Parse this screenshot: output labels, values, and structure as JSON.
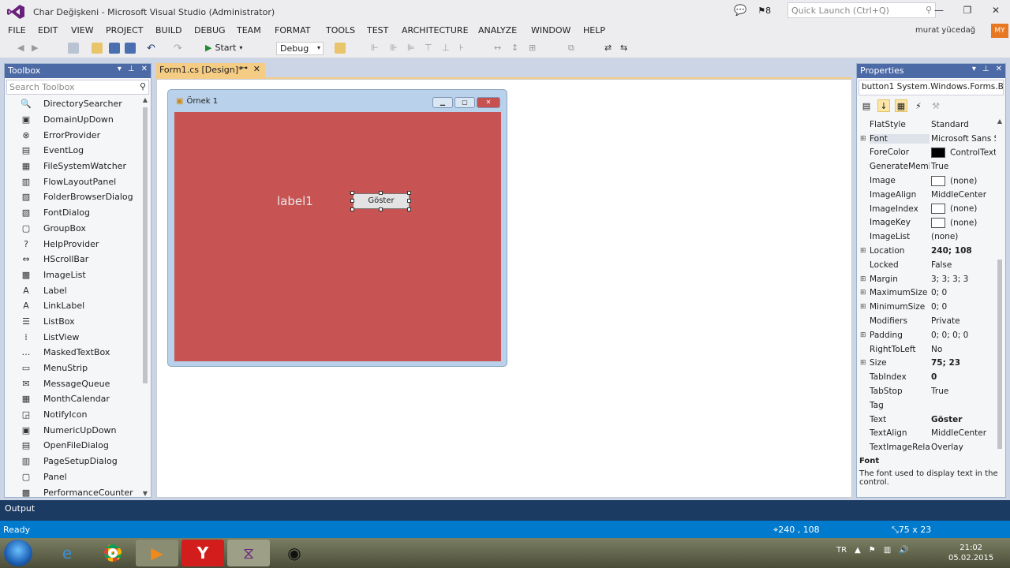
{
  "window": {
    "title": "Char Değişkeni - Microsoft Visual Studio (Administrator)",
    "notifications": "8",
    "quick_launch_placeholder": "Quick Launch (Ctrl+Q)"
  },
  "menu": {
    "items": [
      "FILE",
      "EDIT",
      "VIEW",
      "PROJECT",
      "BUILD",
      "DEBUG",
      "TEAM",
      "FORMAT",
      "TOOLS",
      "TEST",
      "ARCHITECTURE",
      "ANALYZE",
      "WINDOW",
      "HELP"
    ],
    "user": "murat yücedağ",
    "avatar": "MY"
  },
  "toolbar": {
    "start_label": "Start",
    "config": "Debug"
  },
  "toolbox": {
    "title": "Toolbox",
    "search_placeholder": "Search Toolbox",
    "items": [
      {
        "label": "DirectorySearcher",
        "icon": "directory-searcher-icon",
        "glyph": "🔍"
      },
      {
        "label": "DomainUpDown",
        "icon": "domain-updown-icon",
        "glyph": "▣"
      },
      {
        "label": "ErrorProvider",
        "icon": "error-provider-icon",
        "glyph": "⊗"
      },
      {
        "label": "EventLog",
        "icon": "event-log-icon",
        "glyph": "▤"
      },
      {
        "label": "FileSystemWatcher",
        "icon": "file-system-watcher-icon",
        "glyph": "▦"
      },
      {
        "label": "FlowLayoutPanel",
        "icon": "flow-layout-panel-icon",
        "glyph": "▥"
      },
      {
        "label": "FolderBrowserDialog",
        "icon": "folder-browser-dialog-icon",
        "glyph": "▨"
      },
      {
        "label": "FontDialog",
        "icon": "font-dialog-icon",
        "glyph": "▧"
      },
      {
        "label": "GroupBox",
        "icon": "group-box-icon",
        "glyph": "▢"
      },
      {
        "label": "HelpProvider",
        "icon": "help-provider-icon",
        "glyph": "?"
      },
      {
        "label": "HScrollBar",
        "icon": "hscrollbar-icon",
        "glyph": "⇔"
      },
      {
        "label": "ImageList",
        "icon": "image-list-icon",
        "glyph": "▩"
      },
      {
        "label": "Label",
        "icon": "label-icon",
        "glyph": "A"
      },
      {
        "label": "LinkLabel",
        "icon": "link-label-icon",
        "glyph": "A"
      },
      {
        "label": "ListBox",
        "icon": "list-box-icon",
        "glyph": "☰"
      },
      {
        "label": "ListView",
        "icon": "list-view-icon",
        "glyph": "⁞"
      },
      {
        "label": "MaskedTextBox",
        "icon": "masked-textbox-icon",
        "glyph": "…"
      },
      {
        "label": "MenuStrip",
        "icon": "menu-strip-icon",
        "glyph": "▭"
      },
      {
        "label": "MessageQueue",
        "icon": "message-queue-icon",
        "glyph": "✉"
      },
      {
        "label": "MonthCalendar",
        "icon": "month-calendar-icon",
        "glyph": "▦"
      },
      {
        "label": "NotifyIcon",
        "icon": "notify-icon-icon",
        "glyph": "◲"
      },
      {
        "label": "NumericUpDown",
        "icon": "numeric-updown-icon",
        "glyph": "▣"
      },
      {
        "label": "OpenFileDialog",
        "icon": "open-file-dialog-icon",
        "glyph": "▤"
      },
      {
        "label": "PageSetupDialog",
        "icon": "page-setup-dialog-icon",
        "glyph": "▥"
      },
      {
        "label": "Panel",
        "icon": "panel-icon",
        "glyph": "▢"
      },
      {
        "label": "PerformanceCounter",
        "icon": "performance-counter-icon",
        "glyph": "▩"
      }
    ]
  },
  "document_tab": {
    "label": "Form1.cs [Design]*"
  },
  "form": {
    "title": "Örnek 1",
    "label_text": "label1",
    "button_text": "Göster",
    "backcolor": "#c75453"
  },
  "properties": {
    "title": "Properties",
    "object": "button1  System.Windows.Forms.B",
    "rows": [
      {
        "name": "FlatStyle",
        "value": "Standard",
        "exp": ""
      },
      {
        "name": "Font",
        "value": "Microsoft Sans S",
        "exp": "⊞",
        "sel": true
      },
      {
        "name": "ForeColor",
        "value": "ControlText",
        "exp": "",
        "swatch": "#000000"
      },
      {
        "name": "GenerateMember",
        "value": "True",
        "exp": ""
      },
      {
        "name": "Image",
        "value": "(none)",
        "exp": "",
        "swatch": "#ffffff"
      },
      {
        "name": "ImageAlign",
        "value": "MiddleCenter",
        "exp": ""
      },
      {
        "name": "ImageIndex",
        "value": "(none)",
        "exp": "",
        "swatch": "#ffffff"
      },
      {
        "name": "ImageKey",
        "value": "(none)",
        "exp": "",
        "swatch": "#ffffff"
      },
      {
        "name": "ImageList",
        "value": "(none)",
        "exp": ""
      },
      {
        "name": "Location",
        "value": "240; 108",
        "exp": "⊞",
        "bold": true
      },
      {
        "name": "Locked",
        "value": "False",
        "exp": ""
      },
      {
        "name": "Margin",
        "value": "3; 3; 3; 3",
        "exp": "⊞"
      },
      {
        "name": "MaximumSize",
        "value": "0; 0",
        "exp": "⊞"
      },
      {
        "name": "MinimumSize",
        "value": "0; 0",
        "exp": "⊞"
      },
      {
        "name": "Modifiers",
        "value": "Private",
        "exp": ""
      },
      {
        "name": "Padding",
        "value": "0; 0; 0; 0",
        "exp": "⊞"
      },
      {
        "name": "RightToLeft",
        "value": "No",
        "exp": ""
      },
      {
        "name": "Size",
        "value": "75; 23",
        "exp": "⊞",
        "bold": true
      },
      {
        "name": "TabIndex",
        "value": "0",
        "exp": "",
        "bold": true
      },
      {
        "name": "TabStop",
        "value": "True",
        "exp": ""
      },
      {
        "name": "Tag",
        "value": "",
        "exp": ""
      },
      {
        "name": "Text",
        "value": "Göster",
        "exp": "",
        "bold": true
      },
      {
        "name": "TextAlign",
        "value": "MiddleCenter",
        "exp": ""
      },
      {
        "name": "TextImageRelation",
        "value": "Overlay",
        "exp": ""
      }
    ],
    "desc_title": "Font",
    "desc_text": "The font used to display text in the control."
  },
  "output": {
    "label": "Output"
  },
  "status": {
    "ready": "Ready",
    "location": "240 , 108",
    "size": "75 x 23"
  },
  "taskbar": {
    "lang": "TR",
    "time": "21:02",
    "date": "05.02.2015"
  },
  "colors": {
    "accent": "#007acc",
    "tab_active": "#f5cc84",
    "panel_header": "#4c6aa6"
  }
}
